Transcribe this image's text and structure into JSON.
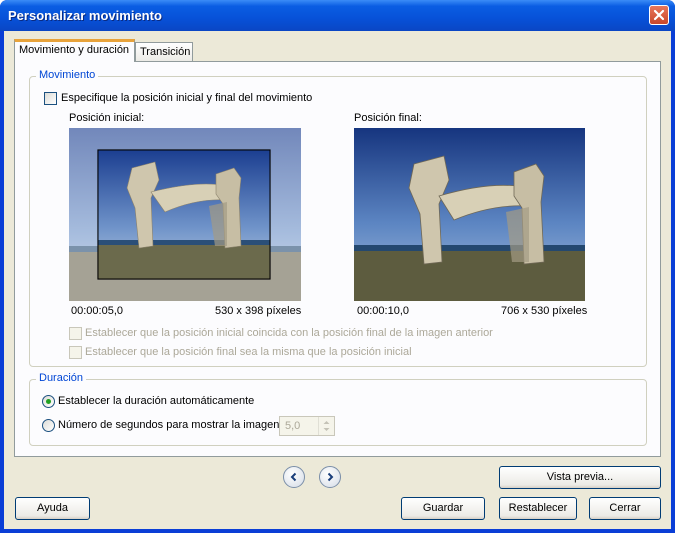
{
  "window": {
    "title": "Personalizar movimiento"
  },
  "tabs": [
    {
      "label": "Movimiento y duración",
      "active": true
    },
    {
      "label": "Transición",
      "active": false
    }
  ],
  "movement": {
    "legend": "Movimiento",
    "specify_checkbox_label": "Especifique la posición inicial y final del movimiento",
    "specify_checked": false,
    "start": {
      "label": "Posición inicial:",
      "time": "00:00:05,0",
      "size": "530 x 398 píxeles"
    },
    "end": {
      "label": "Posición final:",
      "time": "00:00:10,0",
      "size": "706 x 530 píxeles"
    },
    "option_match_prev_label": "Establecer que la posición inicial coincida con la posición final de la imagen anterior",
    "option_same_label": "Establecer que la posición final sea la misma que la posición inicial"
  },
  "duration": {
    "legend": "Duración",
    "auto_label": "Establecer la duración automáticamente",
    "auto_selected": true,
    "seconds_label": "Número de segundos para mostrar la imagen",
    "seconds_value": "5,0"
  },
  "buttons": {
    "preview": "Vista previa...",
    "help": "Ayuda",
    "save": "Guardar",
    "reset": "Restablecer",
    "close": "Cerrar"
  },
  "icons": {
    "prev": "chevron-left-icon",
    "next": "chevron-right-icon",
    "close": "close-icon"
  },
  "colors": {
    "titlebar": "#0a5de3",
    "legend_text": "#0046d5",
    "close_button": "#d9542f"
  }
}
